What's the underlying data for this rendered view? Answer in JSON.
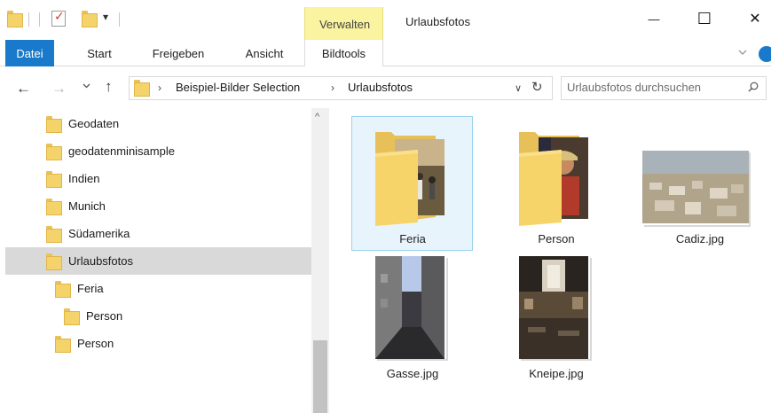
{
  "titlebar": {
    "title": "Urlaubsfotos",
    "context_tab": "Verwalten",
    "qat_dropdown": "▾",
    "minimize": "—",
    "maximize": "☐",
    "close": "✕"
  },
  "ribbon": {
    "tabs": [
      "Datei",
      "Start",
      "Freigeben",
      "Ansicht",
      "Bildtools"
    ],
    "active_color": "#1979ca",
    "context_color": "#faf3a0"
  },
  "address": {
    "crumbs": [
      "Beispiel-Bilder Selection",
      "Urlaubsfotos"
    ],
    "chevron": "›",
    "dropdown": "∨",
    "refresh": "↻"
  },
  "search": {
    "placeholder": "Urlaubsfotos durchsuchen"
  },
  "nav": {
    "items": [
      {
        "label": "Geodaten",
        "level": 0,
        "selected": false
      },
      {
        "label": "geodatenminisample",
        "level": 0,
        "selected": false
      },
      {
        "label": "Indien",
        "level": 0,
        "selected": false
      },
      {
        "label": "Munich",
        "level": 0,
        "selected": false
      },
      {
        "label": "Südamerika",
        "level": 0,
        "selected": false
      },
      {
        "label": "Urlaubsfotos",
        "level": 0,
        "selected": true
      },
      {
        "label": "Feria",
        "level": 1,
        "selected": false
      },
      {
        "label": "Person",
        "level": 2,
        "selected": false
      },
      {
        "label": "Person",
        "level": 1,
        "selected": false
      }
    ]
  },
  "files": [
    {
      "name": "Feria",
      "kind": "folder",
      "selected": true
    },
    {
      "name": "Person",
      "kind": "folder",
      "selected": false
    },
    {
      "name": "Cadiz.jpg",
      "kind": "image",
      "selected": false
    },
    {
      "name": "Gasse.jpg",
      "kind": "image",
      "selected": false
    },
    {
      "name": "Kneipe.jpg",
      "kind": "image",
      "selected": false
    }
  ],
  "icons": {
    "back": "←",
    "forward": "→",
    "recent": "∨",
    "up": "↑",
    "scroll_up": "^"
  }
}
